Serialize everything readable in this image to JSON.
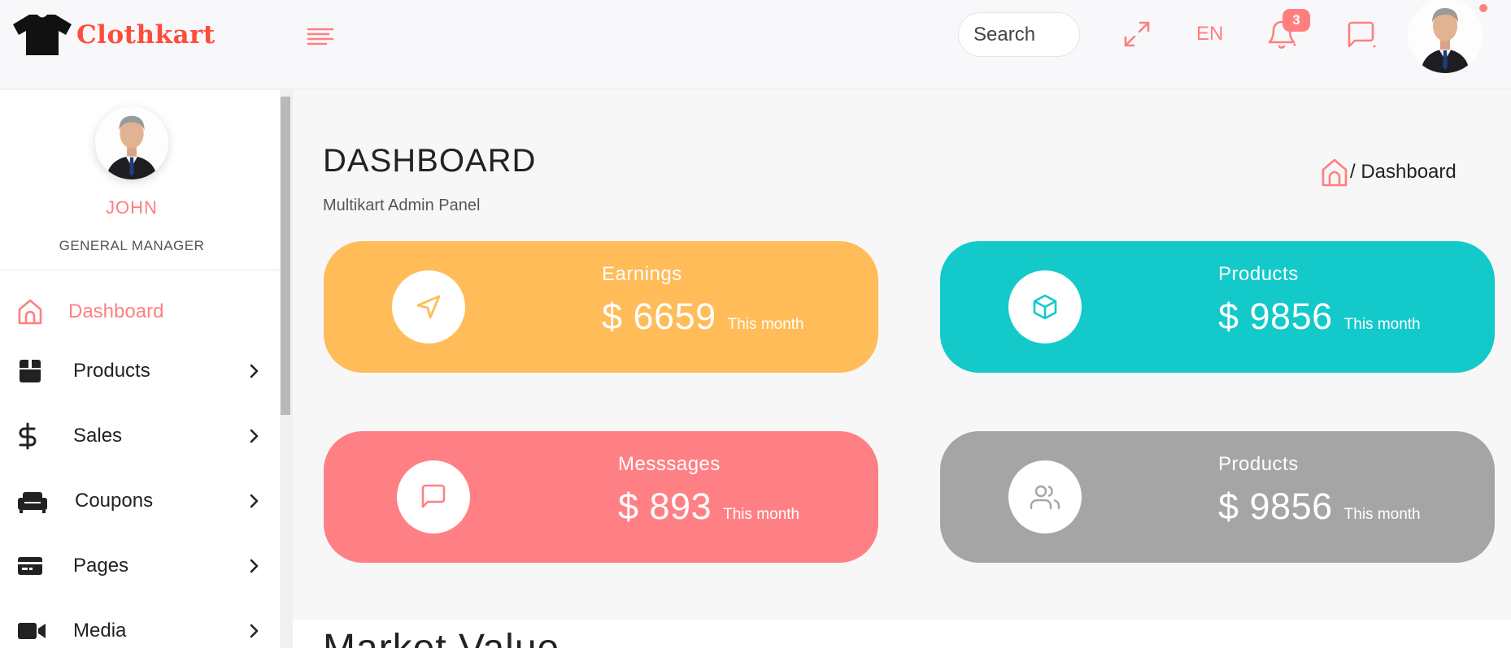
{
  "brand": {
    "name": "Clothkart",
    "primary_color": "#ff4c3b",
    "accent_color": "#ff7f7f"
  },
  "header": {
    "search_placeholder": "Search",
    "language": "EN",
    "notification_count": "3",
    "icons": [
      "menu-icon",
      "fullscreen-icon",
      "bell-icon",
      "message-icon"
    ]
  },
  "sidebar": {
    "user_name": "JOHN",
    "user_role": "GENERAL MANAGER",
    "items": [
      {
        "label": "Dashboard",
        "icon": "home-icon",
        "active": true
      },
      {
        "label": "Products",
        "icon": "box-icon",
        "has_submenu": true
      },
      {
        "label": "Sales",
        "icon": "dollar-icon",
        "has_submenu": true
      },
      {
        "label": "Coupons",
        "icon": "couch-icon",
        "has_submenu": true
      },
      {
        "label": "Pages",
        "icon": "card-icon",
        "has_submenu": true
      },
      {
        "label": "Media",
        "icon": "video-icon",
        "has_submenu": true
      }
    ]
  },
  "main": {
    "title": "DASHBOARD",
    "subtitle": "Multikart Admin Panel",
    "breadcrumb": "/ Dashboard",
    "cards": [
      {
        "title": "Earnings",
        "value": "$ 6659",
        "period": "This month",
        "color": "#ffbc58",
        "icon": "navigation-icon"
      },
      {
        "title": "Products",
        "value": "$ 9856",
        "period": "This month",
        "color": "#13c9ca",
        "icon": "box-icon"
      },
      {
        "title": "Messsages",
        "value": "$ 893",
        "period": "This month",
        "color": "#ff8084",
        "icon": "message-icon"
      },
      {
        "title": "Products",
        "value": "$ 9856",
        "period": "This month",
        "color": "#a5a5a5",
        "icon": "users-icon"
      }
    ],
    "section_title": "Market Value"
  }
}
